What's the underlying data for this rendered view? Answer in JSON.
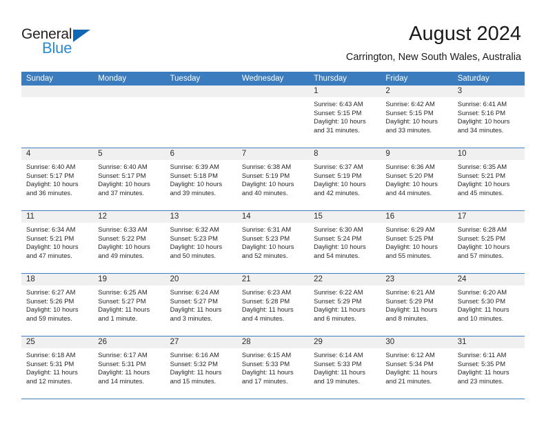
{
  "brand": {
    "name_top": "General",
    "name_bottom": "Blue",
    "triangle_color": "#1267b2",
    "blue_text_color": "#2b8bd4"
  },
  "header": {
    "title": "August 2024",
    "location": "Carrington, New South Wales, Australia"
  },
  "theme": {
    "header_bar_color": "#3a7cbe",
    "day_band_color": "#f0f0f0",
    "grid_line_color": "#3a7cbe",
    "text_color": "#262626"
  },
  "weekday_headers": [
    "Sunday",
    "Monday",
    "Tuesday",
    "Wednesday",
    "Thursday",
    "Friday",
    "Saturday"
  ],
  "weeks": [
    [
      {
        "day": "",
        "empty": true,
        "sunrise": "",
        "sunset": "",
        "daylight_line1": "",
        "daylight_line2": ""
      },
      {
        "day": "",
        "empty": true,
        "sunrise": "",
        "sunset": "",
        "daylight_line1": "",
        "daylight_line2": ""
      },
      {
        "day": "",
        "empty": true,
        "sunrise": "",
        "sunset": "",
        "daylight_line1": "",
        "daylight_line2": ""
      },
      {
        "day": "",
        "empty": true,
        "sunrise": "",
        "sunset": "",
        "daylight_line1": "",
        "daylight_line2": ""
      },
      {
        "day": "1",
        "empty": false,
        "sunrise": "Sunrise: 6:43 AM",
        "sunset": "Sunset: 5:15 PM",
        "daylight_line1": "Daylight: 10 hours",
        "daylight_line2": "and 31 minutes."
      },
      {
        "day": "2",
        "empty": false,
        "sunrise": "Sunrise: 6:42 AM",
        "sunset": "Sunset: 5:15 PM",
        "daylight_line1": "Daylight: 10 hours",
        "daylight_line2": "and 33 minutes."
      },
      {
        "day": "3",
        "empty": false,
        "sunrise": "Sunrise: 6:41 AM",
        "sunset": "Sunset: 5:16 PM",
        "daylight_line1": "Daylight: 10 hours",
        "daylight_line2": "and 34 minutes."
      }
    ],
    [
      {
        "day": "4",
        "empty": false,
        "sunrise": "Sunrise: 6:40 AM",
        "sunset": "Sunset: 5:17 PM",
        "daylight_line1": "Daylight: 10 hours",
        "daylight_line2": "and 36 minutes."
      },
      {
        "day": "5",
        "empty": false,
        "sunrise": "Sunrise: 6:40 AM",
        "sunset": "Sunset: 5:17 PM",
        "daylight_line1": "Daylight: 10 hours",
        "daylight_line2": "and 37 minutes."
      },
      {
        "day": "6",
        "empty": false,
        "sunrise": "Sunrise: 6:39 AM",
        "sunset": "Sunset: 5:18 PM",
        "daylight_line1": "Daylight: 10 hours",
        "daylight_line2": "and 39 minutes."
      },
      {
        "day": "7",
        "empty": false,
        "sunrise": "Sunrise: 6:38 AM",
        "sunset": "Sunset: 5:19 PM",
        "daylight_line1": "Daylight: 10 hours",
        "daylight_line2": "and 40 minutes."
      },
      {
        "day": "8",
        "empty": false,
        "sunrise": "Sunrise: 6:37 AM",
        "sunset": "Sunset: 5:19 PM",
        "daylight_line1": "Daylight: 10 hours",
        "daylight_line2": "and 42 minutes."
      },
      {
        "day": "9",
        "empty": false,
        "sunrise": "Sunrise: 6:36 AM",
        "sunset": "Sunset: 5:20 PM",
        "daylight_line1": "Daylight: 10 hours",
        "daylight_line2": "and 44 minutes."
      },
      {
        "day": "10",
        "empty": false,
        "sunrise": "Sunrise: 6:35 AM",
        "sunset": "Sunset: 5:21 PM",
        "daylight_line1": "Daylight: 10 hours",
        "daylight_line2": "and 45 minutes."
      }
    ],
    [
      {
        "day": "11",
        "empty": false,
        "sunrise": "Sunrise: 6:34 AM",
        "sunset": "Sunset: 5:21 PM",
        "daylight_line1": "Daylight: 10 hours",
        "daylight_line2": "and 47 minutes."
      },
      {
        "day": "12",
        "empty": false,
        "sunrise": "Sunrise: 6:33 AM",
        "sunset": "Sunset: 5:22 PM",
        "daylight_line1": "Daylight: 10 hours",
        "daylight_line2": "and 49 minutes."
      },
      {
        "day": "13",
        "empty": false,
        "sunrise": "Sunrise: 6:32 AM",
        "sunset": "Sunset: 5:23 PM",
        "daylight_line1": "Daylight: 10 hours",
        "daylight_line2": "and 50 minutes."
      },
      {
        "day": "14",
        "empty": false,
        "sunrise": "Sunrise: 6:31 AM",
        "sunset": "Sunset: 5:23 PM",
        "daylight_line1": "Daylight: 10 hours",
        "daylight_line2": "and 52 minutes."
      },
      {
        "day": "15",
        "empty": false,
        "sunrise": "Sunrise: 6:30 AM",
        "sunset": "Sunset: 5:24 PM",
        "daylight_line1": "Daylight: 10 hours",
        "daylight_line2": "and 54 minutes."
      },
      {
        "day": "16",
        "empty": false,
        "sunrise": "Sunrise: 6:29 AM",
        "sunset": "Sunset: 5:25 PM",
        "daylight_line1": "Daylight: 10 hours",
        "daylight_line2": "and 55 minutes."
      },
      {
        "day": "17",
        "empty": false,
        "sunrise": "Sunrise: 6:28 AM",
        "sunset": "Sunset: 5:25 PM",
        "daylight_line1": "Daylight: 10 hours",
        "daylight_line2": "and 57 minutes."
      }
    ],
    [
      {
        "day": "18",
        "empty": false,
        "sunrise": "Sunrise: 6:27 AM",
        "sunset": "Sunset: 5:26 PM",
        "daylight_line1": "Daylight: 10 hours",
        "daylight_line2": "and 59 minutes."
      },
      {
        "day": "19",
        "empty": false,
        "sunrise": "Sunrise: 6:25 AM",
        "sunset": "Sunset: 5:27 PM",
        "daylight_line1": "Daylight: 11 hours",
        "daylight_line2": "and 1 minute."
      },
      {
        "day": "20",
        "empty": false,
        "sunrise": "Sunrise: 6:24 AM",
        "sunset": "Sunset: 5:27 PM",
        "daylight_line1": "Daylight: 11 hours",
        "daylight_line2": "and 3 minutes."
      },
      {
        "day": "21",
        "empty": false,
        "sunrise": "Sunrise: 6:23 AM",
        "sunset": "Sunset: 5:28 PM",
        "daylight_line1": "Daylight: 11 hours",
        "daylight_line2": "and 4 minutes."
      },
      {
        "day": "22",
        "empty": false,
        "sunrise": "Sunrise: 6:22 AM",
        "sunset": "Sunset: 5:29 PM",
        "daylight_line1": "Daylight: 11 hours",
        "daylight_line2": "and 6 minutes."
      },
      {
        "day": "23",
        "empty": false,
        "sunrise": "Sunrise: 6:21 AM",
        "sunset": "Sunset: 5:29 PM",
        "daylight_line1": "Daylight: 11 hours",
        "daylight_line2": "and 8 minutes."
      },
      {
        "day": "24",
        "empty": false,
        "sunrise": "Sunrise: 6:20 AM",
        "sunset": "Sunset: 5:30 PM",
        "daylight_line1": "Daylight: 11 hours",
        "daylight_line2": "and 10 minutes."
      }
    ],
    [
      {
        "day": "25",
        "empty": false,
        "sunrise": "Sunrise: 6:18 AM",
        "sunset": "Sunset: 5:31 PM",
        "daylight_line1": "Daylight: 11 hours",
        "daylight_line2": "and 12 minutes."
      },
      {
        "day": "26",
        "empty": false,
        "sunrise": "Sunrise: 6:17 AM",
        "sunset": "Sunset: 5:31 PM",
        "daylight_line1": "Daylight: 11 hours",
        "daylight_line2": "and 14 minutes."
      },
      {
        "day": "27",
        "empty": false,
        "sunrise": "Sunrise: 6:16 AM",
        "sunset": "Sunset: 5:32 PM",
        "daylight_line1": "Daylight: 11 hours",
        "daylight_line2": "and 15 minutes."
      },
      {
        "day": "28",
        "empty": false,
        "sunrise": "Sunrise: 6:15 AM",
        "sunset": "Sunset: 5:33 PM",
        "daylight_line1": "Daylight: 11 hours",
        "daylight_line2": "and 17 minutes."
      },
      {
        "day": "29",
        "empty": false,
        "sunrise": "Sunrise: 6:14 AM",
        "sunset": "Sunset: 5:33 PM",
        "daylight_line1": "Daylight: 11 hours",
        "daylight_line2": "and 19 minutes."
      },
      {
        "day": "30",
        "empty": false,
        "sunrise": "Sunrise: 6:12 AM",
        "sunset": "Sunset: 5:34 PM",
        "daylight_line1": "Daylight: 11 hours",
        "daylight_line2": "and 21 minutes."
      },
      {
        "day": "31",
        "empty": false,
        "sunrise": "Sunrise: 6:11 AM",
        "sunset": "Sunset: 5:35 PM",
        "daylight_line1": "Daylight: 11 hours",
        "daylight_line2": "and 23 minutes."
      }
    ]
  ]
}
